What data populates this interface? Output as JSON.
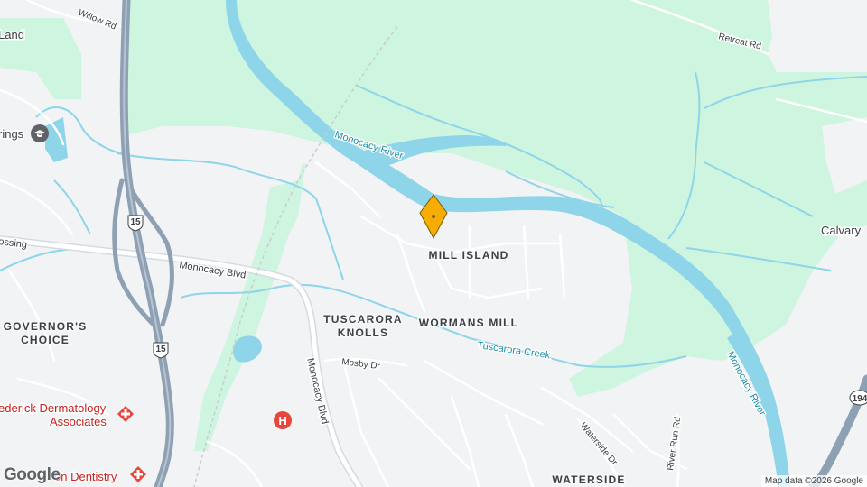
{
  "colors": {
    "land": "#f1f3f4",
    "park": "#cef5df",
    "water": "#8fd5ea",
    "highway": "#8da0b4",
    "road": "#ffffff",
    "marker": "#f6ac00",
    "poi": "#e8453c"
  },
  "places": {
    "mill_island": "MILL ISLAND",
    "wormans_mill": "WORMANS MILL",
    "tuscarora_line1": "TUSCARORA",
    "tuscarora_line2": "KNOLLS",
    "governors_line1": "GOVERNOR'S",
    "governors_line2": "CHOICE",
    "waterside": "WATERSIDE",
    "calvary": "Calvary",
    "land_fragment": "Land",
    "springs_fragment": "rings"
  },
  "roads": {
    "willow": "Willow Rd",
    "retreat": "Retreat Rd",
    "monocacy_blvd_ew": "Monocacy Blvd",
    "monocacy_blvd_ns": "Monocacy Blvd",
    "crossing": "ossing",
    "mosby": "Mosby Dr",
    "waterside_dr": "Waterside Dr",
    "river_run": "River Run Rd"
  },
  "water": {
    "river_main": "Monocacy River",
    "river_east": "Monocacy River",
    "creek": "Tuscarora Creek"
  },
  "shields": {
    "us15_top": "15",
    "us15_bottom": "15",
    "md194": "194"
  },
  "pois": {
    "dermatology_line1": "ederick Dermatology",
    "dermatology_line2": "Associates",
    "dentistry": "on Dentistry"
  },
  "icons": {
    "school": "school-icon",
    "hospital": "hospital-icon",
    "medical": "medical-icon",
    "pin": "location-pin-icon"
  },
  "footer": {
    "logo": "Google",
    "attribution": "Map data ©2026 Google"
  }
}
